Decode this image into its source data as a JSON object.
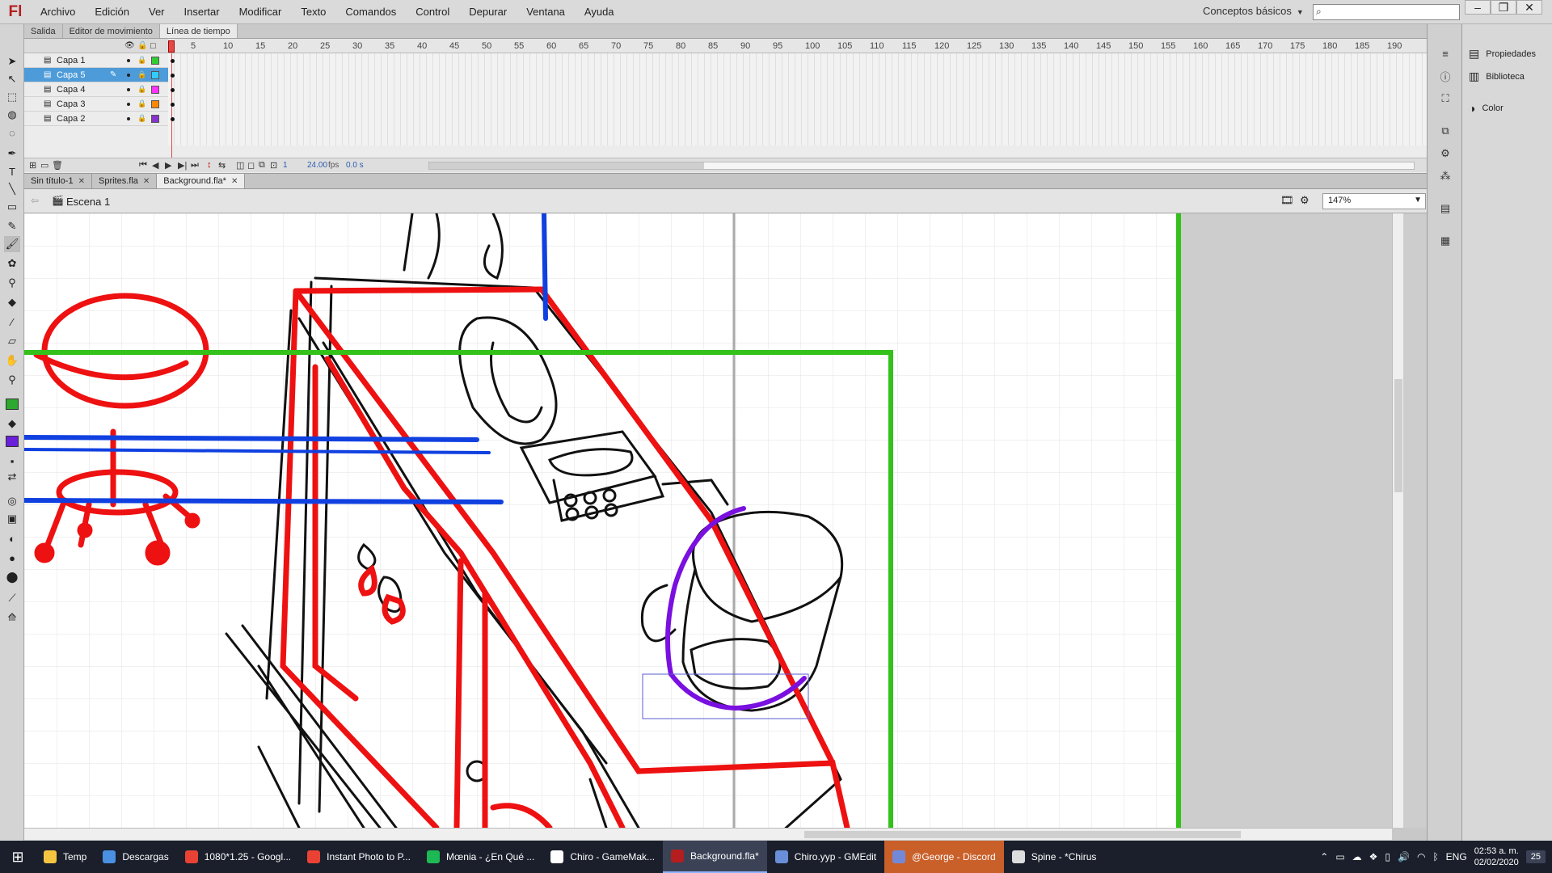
{
  "app": {
    "logo": "Fl"
  },
  "menu": [
    "Archivo",
    "Edición",
    "Ver",
    "Insertar",
    "Modificar",
    "Texto",
    "Comandos",
    "Control",
    "Depurar",
    "Ventana",
    "Ayuda"
  ],
  "workspace": {
    "label": "Conceptos básicos"
  },
  "search": {
    "placeholder": ""
  },
  "panel_tabs": [
    "Salida",
    "Editor de movimiento",
    "Línea de tiempo"
  ],
  "timeline": {
    "frame_numbers": [
      "1",
      "5",
      "10",
      "15",
      "20",
      "25",
      "30",
      "35",
      "40",
      "45",
      "50",
      "55",
      "60",
      "65",
      "70",
      "75",
      "80",
      "85",
      "90",
      "95",
      "100",
      "105",
      "110",
      "115",
      "120",
      "125",
      "130",
      "135",
      "140",
      "145",
      "150",
      "155",
      "160",
      "165",
      "170",
      "175",
      "180",
      "185",
      "190"
    ],
    "layers": [
      {
        "name": "Capa 1",
        "color": "#33cc33",
        "selected": false
      },
      {
        "name": "Capa 5",
        "color": "#33ccff",
        "selected": true
      },
      {
        "name": "Capa 4",
        "color": "#ff33ff",
        "selected": false
      },
      {
        "name": "Capa 3",
        "color": "#ff8800",
        "selected": false
      },
      {
        "name": "Capa 2",
        "color": "#8833cc",
        "selected": false
      }
    ],
    "current_frame": "1",
    "fps": "24.00",
    "fps_unit": "fps",
    "time": "0.0 s"
  },
  "doc_tabs": [
    {
      "label": "Sin título-1",
      "active": false
    },
    {
      "label": "Sprites.fla",
      "active": false
    },
    {
      "label": "Background.fla*",
      "active": true
    }
  ],
  "scene": {
    "label": "Escena 1"
  },
  "zoom": {
    "value": "147%"
  },
  "right_panels": [
    "Propiedades",
    "Biblioteca",
    "Color"
  ],
  "taskbar": {
    "items": [
      {
        "label": "Temp",
        "color": "#f5c542",
        "state": "normal"
      },
      {
        "label": "Descargas",
        "color": "#4a90e2",
        "state": "normal"
      },
      {
        "label": "1080*1.25 - Googl...",
        "color": "#e94235",
        "state": "normal"
      },
      {
        "label": "Instant Photo to P...",
        "color": "#e94235",
        "state": "normal"
      },
      {
        "label": "Mœnia - ¿En Qué ...",
        "color": "#1db954",
        "state": "normal"
      },
      {
        "label": "Chiro - GameMak...",
        "color": "#ffffff",
        "state": "normal"
      },
      {
        "label": "Background.fla*",
        "color": "#b41e1e",
        "state": "active"
      },
      {
        "label": "Chiro.yyp - GMEdit",
        "color": "#6a8fd8",
        "state": "normal"
      },
      {
        "label": "@George - Discord",
        "color": "#7289da",
        "state": "highlight"
      },
      {
        "label": "Spine - *Chirus",
        "color": "#dddddd",
        "state": "normal"
      }
    ],
    "language": "ENG",
    "time": "02:53 a. m.",
    "date": "02/02/2020",
    "notifications": "25"
  }
}
